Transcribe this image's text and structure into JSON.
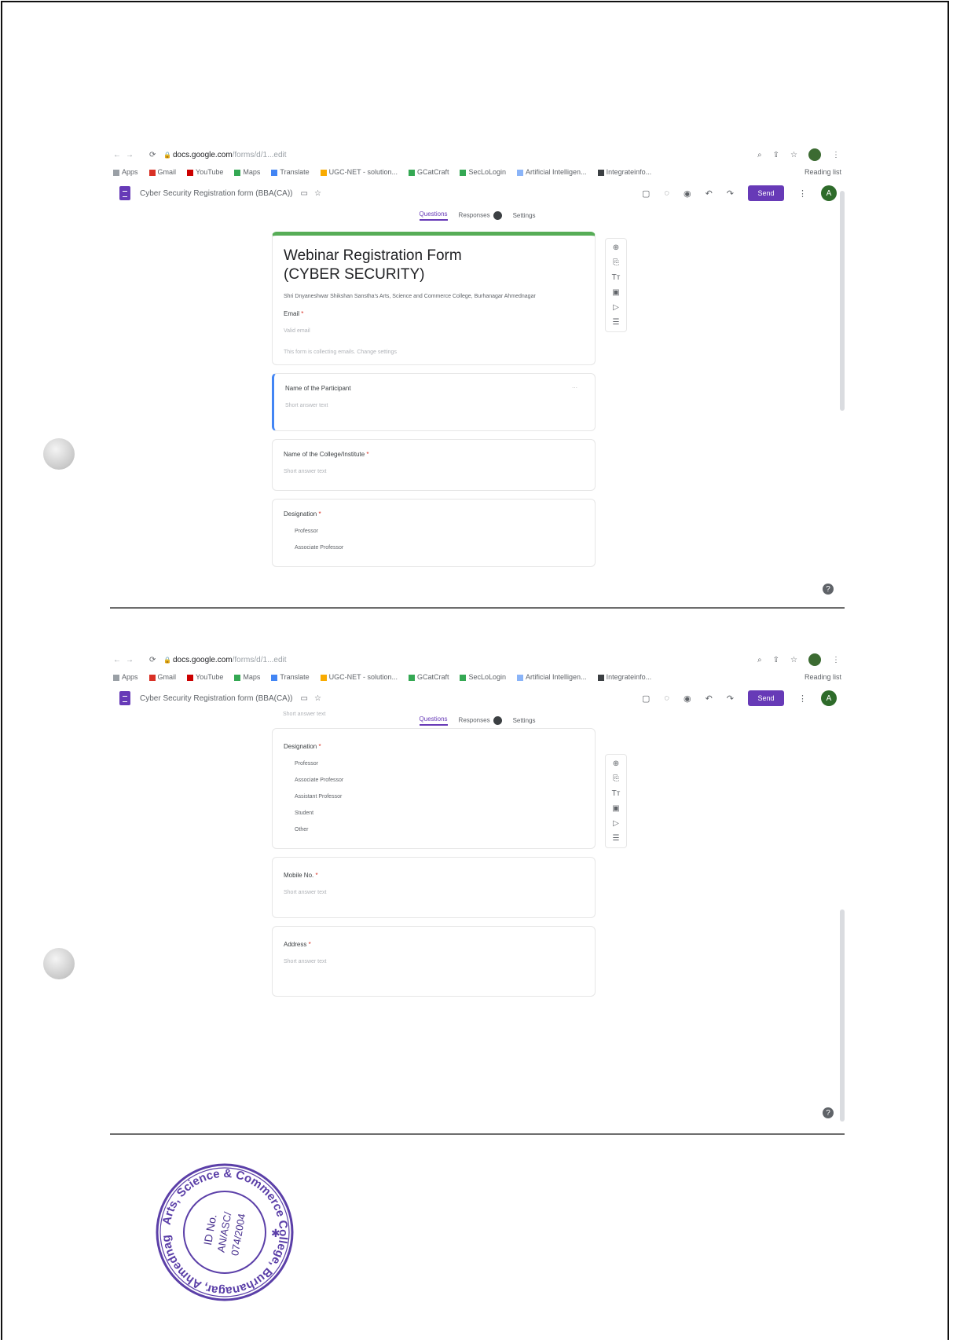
{
  "browser": {
    "url": "docs.google.com",
    "url_rest": "/forms/d/1...edit",
    "bookmarks": [
      "Apps",
      "Gmail",
      "YouTube",
      "Maps",
      "Translate",
      "UGC-NET - solution...",
      "GCatCraft",
      "SecLoLogin",
      "Artificial Intelligen...",
      "Integrateinfo..."
    ],
    "reading_list": "Reading list"
  },
  "forms_app": {
    "doc_title": "Cyber Security Registration form (BBA(CA))",
    "send_label": "Send",
    "avatar_letter": "A"
  },
  "tabs": {
    "questions": "Questions",
    "responses": "Responses",
    "settings": "Settings"
  },
  "form": {
    "title_line1": "Webinar Registration Form",
    "title_line2": "(CYBER SECURITY)",
    "description": "Shri Dnyaneshwar Shikshan Sanstha's Arts, Science and Commerce College, Burhanagar Ahmednagar",
    "email_label": "Email",
    "email_placeholder": "Valid email",
    "email_note": "This form is collecting emails. Change settings",
    "answer_placeholder": "Short answer text",
    "q_participant": "Name of the Participant",
    "q_college": "Name of the College/Institute",
    "q_designation": "Designation",
    "designation_options": [
      "Professor",
      "Associate Professor",
      "Assistant Professor",
      "Student",
      "Other"
    ],
    "q_mobile": "Mobile No.",
    "q_address": "Address"
  },
  "stamp": {
    "outer_text": "Arts, Science & Commerce College, Burhanagar, Ahmednagar-414002",
    "id_line1": "ID No.",
    "id_line2": "AN/ASC/",
    "id_line3": "074/2004"
  }
}
